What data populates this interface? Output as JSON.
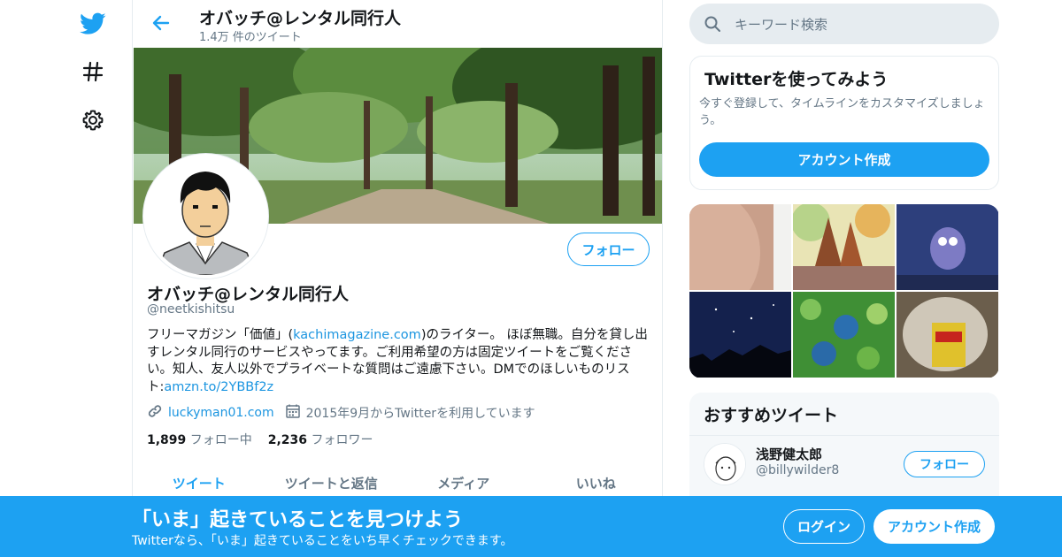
{
  "top": {
    "title": "オバッチ@レンタル同行人",
    "tweet_count": "1.4万 件のツイート"
  },
  "profile": {
    "follow_label": "フォロー",
    "name": "オバッチ@レンタル同行人",
    "handle": "@neetkishitsu",
    "bio_1": "フリーマガジン「価値」(",
    "bio_link_1": "kachimagazine.com",
    "bio_2": ")のライター。 ほぼ無職。自分を貸し出すレンタル同行のサービスやってます。ご利用希望の方は固定ツイートをご覧ください。知人、友人以外でプライベートな質問はご遠慮下さい。DMでのほしいものリスト:",
    "bio_link_2": "amzn.to/2YBBf2z",
    "website": "luckyman01.com",
    "joined": "2015年9月からTwitterを利用しています",
    "following_count": "1,899",
    "following_label": "フォロー中",
    "followers_count": "2,236",
    "followers_label": "フォロワー"
  },
  "tabs": [
    {
      "label": "ツイート",
      "active": true
    },
    {
      "label": "ツイートと返信",
      "active": false
    },
    {
      "label": "メディア",
      "active": false
    },
    {
      "label": "いいね",
      "active": false
    }
  ],
  "search": {
    "placeholder": "キーワード検索"
  },
  "try_card": {
    "title": "Twitterを使ってみよう",
    "subtitle": "今すぐ登録して、タイムラインをカスタマイズしましょう。",
    "button": "アカウント作成"
  },
  "recommend": {
    "title": "おすすめツイート",
    "user_name": "浅野健太郎",
    "user_handle": "@billywilder8",
    "follow_label": "フォロー"
  },
  "bottom_bar": {
    "title": "「いま」起きていることを見つけよう",
    "subtitle": "Twitterなら、「いま」起きていることをいち早くチェックできます。",
    "login": "ログイン",
    "signup": "アカウント作成"
  },
  "colors": {
    "accent": "#1da1f2",
    "text": "#14171a",
    "secondary": "#657786",
    "border": "#e6ecf0"
  },
  "icons": {
    "logo": "twitter-bird-icon",
    "explore": "hash-icon",
    "settings": "gear-icon",
    "back": "arrow-left-icon",
    "search": "search-icon",
    "website": "link-icon",
    "joined": "calendar-icon"
  }
}
